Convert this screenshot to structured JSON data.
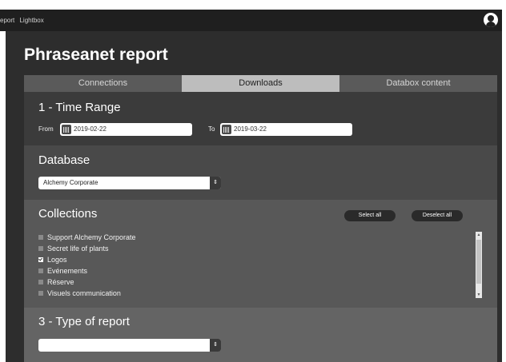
{
  "nav": {
    "items": [
      "eport",
      "Lightbox"
    ]
  },
  "page_title": "Phraseanet report",
  "tabs": [
    {
      "label": "Connections",
      "active": false
    },
    {
      "label": "Downloads",
      "active": true
    },
    {
      "label": "Databox content",
      "active": false
    }
  ],
  "time_range": {
    "title": "1 - Time Range",
    "from_label": "From",
    "from_value": "2019-02-22",
    "to_label": "To",
    "to_value": "2019-03-22"
  },
  "database": {
    "title": "Database",
    "selected": "Alchemy Corporate"
  },
  "collections": {
    "title": "Collections",
    "select_all_label": "Select all",
    "deselect_all_label": "Deselect all",
    "items": [
      {
        "label": "Support Alchemy Corporate",
        "checked": false
      },
      {
        "label": "Secret life of plants",
        "checked": false
      },
      {
        "label": "Logos",
        "checked": true
      },
      {
        "label": "Evénements",
        "checked": false
      },
      {
        "label": "Réserve",
        "checked": false
      },
      {
        "label": "Visuels communication",
        "checked": false
      }
    ]
  },
  "report_type": {
    "title": "3 - Type of report",
    "selected": ""
  },
  "icons": [
    "calendar-icon",
    "user-avatar-icon",
    "select-arrows-icon"
  ]
}
